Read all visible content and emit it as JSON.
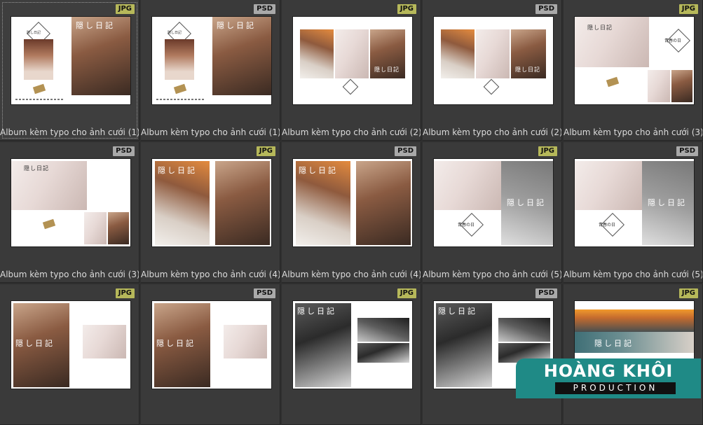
{
  "app": {
    "brand": {
      "title": "HOÀNG KHÔI",
      "subtitle": "PRODUCTION"
    }
  },
  "grid": {
    "items": [
      {
        "badge": "JPG",
        "label": "Album kèm typo cho ảnh cưới (1)",
        "selected": true
      },
      {
        "badge": "PSD",
        "label": "Album kèm typo cho ảnh cưới (1)"
      },
      {
        "badge": "JPG",
        "label": "Album kèm typo cho ảnh cưới (2)"
      },
      {
        "badge": "PSD",
        "label": "Album kèm typo cho ảnh cưới (2)"
      },
      {
        "badge": "JPG",
        "label": "Album kèm typo cho ảnh cưới (3)"
      },
      {
        "badge": "PSD",
        "label": "Album kèm typo cho ảnh cưới (3)"
      },
      {
        "badge": "JPG",
        "label": "Album kèm typo cho ảnh cưới (4)"
      },
      {
        "badge": "PSD",
        "label": "Album kèm typo cho ảnh cưới (4)"
      },
      {
        "badge": "JPG",
        "label": "Album kèm typo cho ảnh cưới (5)"
      },
      {
        "badge": "PSD",
        "label": "Album kèm typo cho ảnh cưới (5)"
      },
      {
        "badge": "JPG",
        "label": ""
      },
      {
        "badge": "PSD",
        "label": ""
      },
      {
        "badge": "JPG",
        "label": ""
      },
      {
        "badge": "PSD",
        "label": ""
      },
      {
        "badge": "JPG",
        "label": ""
      }
    ]
  },
  "thumb_text": {
    "title_typo": "隠し日記",
    "subtitle_typo": "青春の日",
    "stamp_typo": "隠し日記"
  },
  "colors": {
    "background": "#2f2f2f",
    "jpg_badge": "#b6b85a",
    "psd_badge": "#a9a9a9",
    "logo": "#1f8a86"
  }
}
